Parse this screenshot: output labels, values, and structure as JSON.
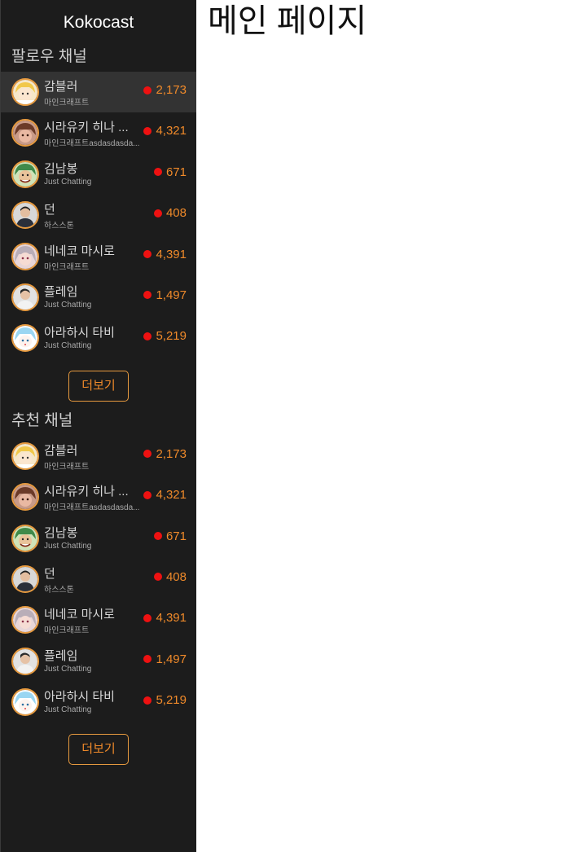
{
  "brand": "Kokocast",
  "main": {
    "title": "메인 페이지"
  },
  "sidebar": {
    "following": {
      "title": "팔로우 채널",
      "more_label": "더보기",
      "channels": [
        {
          "name": "감블러",
          "category": "마인크래프트",
          "viewers": "2,173",
          "avatar": "blonde-character",
          "active": true
        },
        {
          "name": "시라유키 히나 ...",
          "category": "마인크래프트asdasdasda...",
          "viewers": "4,321",
          "avatar": "brown-hair-character"
        },
        {
          "name": "김남봉",
          "category": "Just Chatting",
          "viewers": "671",
          "avatar": "green-hair-character"
        },
        {
          "name": "던",
          "category": "하스스톤",
          "viewers": "408",
          "avatar": "photo-person"
        },
        {
          "name": "네네코 마시로",
          "category": "마인크래프트",
          "viewers": "4,391",
          "avatar": "silver-hair-character"
        },
        {
          "name": "플레임",
          "category": "Just Chatting",
          "viewers": "1,497",
          "avatar": "photo-person-2"
        },
        {
          "name": "아라하시 타비",
          "category": "Just Chatting",
          "viewers": "5,219",
          "avatar": "light-blue-character"
        }
      ]
    },
    "recommended": {
      "title": "추천 채널",
      "more_label": "더보기",
      "channels": [
        {
          "name": "감블러",
          "category": "마인크래프트",
          "viewers": "2,173",
          "avatar": "blonde-character"
        },
        {
          "name": "시라유키 히나 ...",
          "category": "마인크래프트asdasdasda...",
          "viewers": "4,321",
          "avatar": "brown-hair-character"
        },
        {
          "name": "김남봉",
          "category": "Just Chatting",
          "viewers": "671",
          "avatar": "green-hair-character"
        },
        {
          "name": "던",
          "category": "하스스톤",
          "viewers": "408",
          "avatar": "photo-person"
        },
        {
          "name": "네네코 마시로",
          "category": "마인크래프트",
          "viewers": "4,391",
          "avatar": "silver-hair-character"
        },
        {
          "name": "플레임",
          "category": "Just Chatting",
          "viewers": "1,497",
          "avatar": "photo-person-2"
        },
        {
          "name": "아라하시 타비",
          "category": "Just Chatting",
          "viewers": "5,219",
          "avatar": "light-blue-character"
        }
      ]
    }
  },
  "colors": {
    "sidebar_bg": "#1c1c1c",
    "accent": "#f08a2a",
    "live": "#ee1111",
    "active_row": "#333333"
  }
}
